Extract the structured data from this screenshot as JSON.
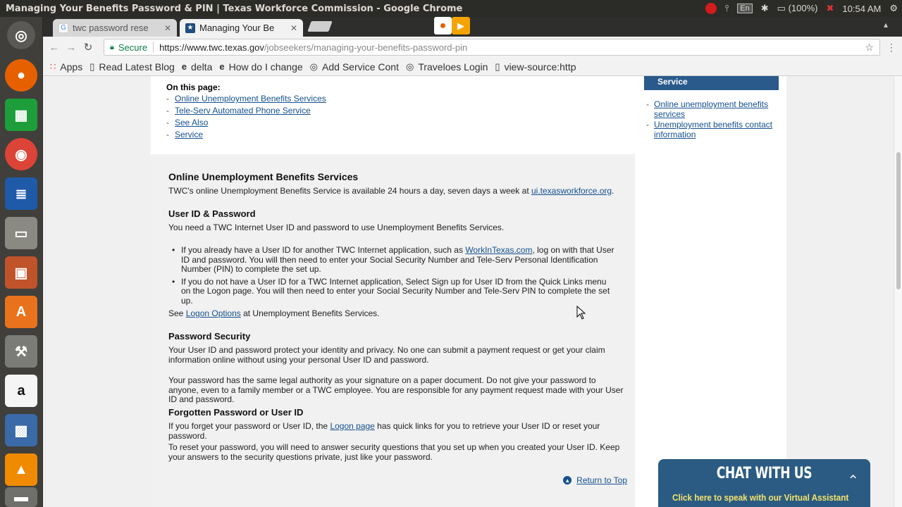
{
  "os": {
    "window_title": "Managing Your Benefits Password & PIN | Texas Workforce Commission - Google Chrome",
    "input_lang": "En",
    "battery": "(100%)",
    "clock": "10:54 AM"
  },
  "tabs": [
    {
      "label": "twc password rese",
      "icon": "google-icon"
    },
    {
      "label": "Managing Your Be",
      "icon": "twc-icon"
    }
  ],
  "address_bar": {
    "secure_label": "Secure",
    "url_host": "https://www.twc.texas.gov",
    "url_path": "/jobseekers/managing-your-benefits-password-pin"
  },
  "bookmarks": [
    {
      "label": "Apps",
      "icon": "apps-grid-icon"
    },
    {
      "label": "Read Latest Blog",
      "icon": "page-icon"
    },
    {
      "label": "delta",
      "icon": "e-icon"
    },
    {
      "label": "How do I change",
      "icon": "e-icon"
    },
    {
      "label": "Add Service Cont",
      "icon": "tool-icon"
    },
    {
      "label": "Traveloes Login",
      "icon": "tool-icon"
    },
    {
      "label": "view-source:http",
      "icon": "page-icon"
    }
  ],
  "on_this_page": {
    "label": "On this page:",
    "links": [
      "Online Unemployment Benefits Services",
      "Tele-Serv Automated Phone Service",
      "See Also",
      "Service"
    ]
  },
  "sidebar": {
    "header": "Service",
    "links": [
      "Online unemployment benefits services",
      "Unemployment benefits contact information"
    ]
  },
  "content": {
    "h_online": "Online Unemployment Benefits Services",
    "p_online_pre": "TWC's online Unemployment Benefits Service is available 24 hours a day, seven days a week at ",
    "p_online_link": "ui.texasworkforce.org",
    "p_online_post": ".",
    "h_userid": "User ID & Password",
    "p_userid": "You need a TWC Internet User ID and password to use Unemployment Benefits Services.",
    "b1_pre": "If you already have a User ID for another TWC Internet application, such as ",
    "b1_link": "WorkInTexas.com",
    "b1_post": ", log on with that User ID and password. You will then need to enter your Social Security Number and Tele-Serv Personal Identification Number (PIN) to complete the set up.",
    "b2": "If you do not have a User ID for a TWC Internet application, Select Sign up for User ID from the Quick Links menu on the Logon page. You will then need to enter your Social Security Number and Tele-Serv PIN to complete the set up.",
    "see_pre": "See ",
    "see_link": "Logon Options",
    "see_post": " at Unemployment Benefits Services.",
    "h_security": "Password Security",
    "p_security1": "Your User ID and password protect your identity and privacy. No one can submit a payment request or get your claim information online without using your personal User ID and password.",
    "p_security2": "Your password has the same legal authority as your signature on a paper document. Do not give your password to anyone, even to a family member or a TWC employee. You are responsible for any payment request made with your User ID and password.",
    "h_forgot": "Forgotten Password or User ID",
    "p_forgot_pre": "If you forget your password or User ID, the ",
    "p_forgot_link": "Logon page",
    "p_forgot_post": " has quick links for you to retrieve your User ID or reset your password.",
    "p_reset": "To reset your password, you will need to answer security questions that you set up when you created your User ID. Keep your answers to the security questions private, just like your password.",
    "return_top": "Return to Top"
  },
  "chat": {
    "title": "CHAT WITH US",
    "subtitle": "Click here to speak with our Virtual Assistant"
  }
}
